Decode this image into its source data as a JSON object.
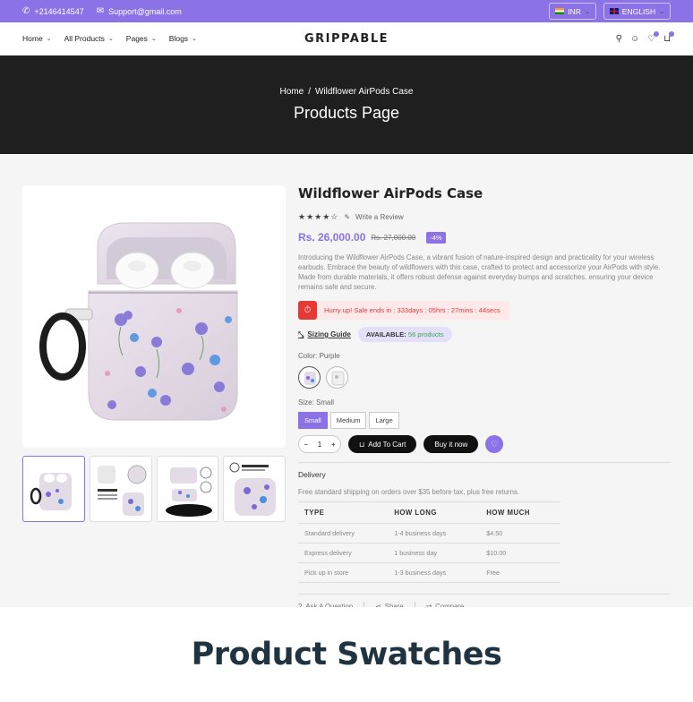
{
  "topbar": {
    "phone": "+2146414547",
    "email": "Support@gmail.com",
    "currency": "INR",
    "language": "ENGLISH"
  },
  "nav": {
    "menu": [
      "Home",
      "All Products",
      "Pages",
      "Blogs"
    ],
    "logo": "GRIPPABLE"
  },
  "hero": {
    "crumb_home": "Home",
    "crumb_sep": "/",
    "crumb_current": "Wildflower AirPods Case",
    "title": "Products Page"
  },
  "product": {
    "title": "Wildflower AirPods Case",
    "rating_stars": "★★★★☆",
    "write_review": "Write a Review",
    "price": "Rs. 26,000.00",
    "compare_price": "Rs. 27,000.00",
    "discount": "-4%",
    "description": "Introducing the Wildflower AirPods Case, a vibrant fusion of nature-inspired design and practicality for your wireless earbuds. Embrace the beauty of wildflowers with this case, crafted to protect and accessorize your AirPods with style. Made from durable materials, it offers robust defense against everyday bumps and scratches, ensuring your device remains safe and secure.",
    "timer_label": "Hurry up! Sale ends in :",
    "timer_value": "333days : 05hrs : 27mins : 44secs",
    "sizing_guide": "Sizing Guide",
    "available_label": "AVAILABLE:",
    "available_count": "56 products",
    "color_label": "Color: Purple",
    "size_label": "Size: Small",
    "sizes": [
      "Small",
      "Medium",
      "Large"
    ],
    "qty_minus": "−",
    "qty_value": "1",
    "qty_plus": "+",
    "add_to_cart": "Add To Cart",
    "buy_now": "Buy it now"
  },
  "delivery": {
    "title": "Delivery",
    "note": "Free standard shipping on orders over $35 before tax, plus free returns.",
    "headers": [
      "TYPE",
      "HOW LONG",
      "HOW MUCH"
    ],
    "rows": [
      [
        "Standard delivery",
        "1-4 business days",
        "$4.50"
      ],
      [
        "Express delivery",
        "1 business day",
        "$10.00"
      ],
      [
        "Pick up in store",
        "1-3 business days",
        "Free"
      ]
    ]
  },
  "meta": {
    "ask": "Ask A Question",
    "share": "Share",
    "compare": "Compare"
  },
  "banner": {
    "title": "Product Swatches"
  },
  "colors": {
    "accent": "#8b72e6",
    "dark": "#1f1f1f",
    "sale_red": "#e53935"
  }
}
